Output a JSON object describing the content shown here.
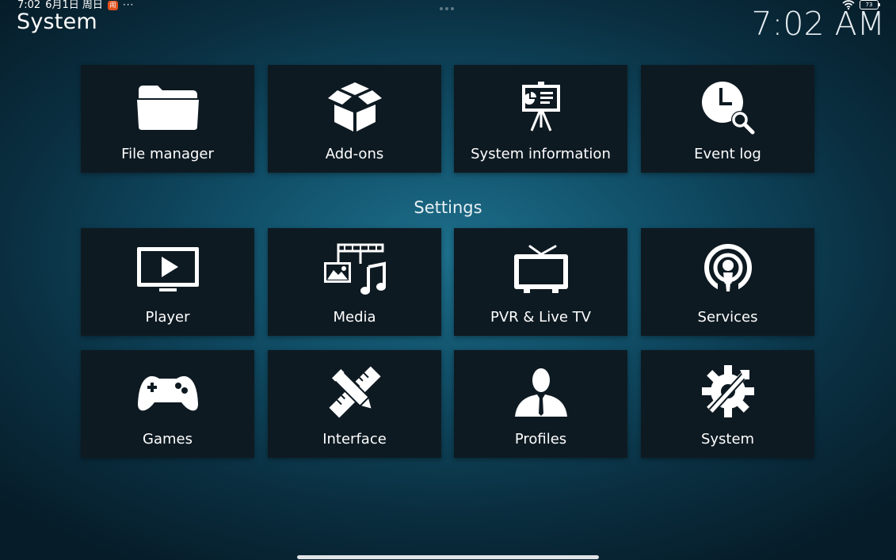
{
  "status_bar": {
    "time": "7:02",
    "date": "6月1日 周日",
    "app_badge": "闹",
    "more": "···",
    "battery": "73"
  },
  "header": {
    "title": "System",
    "clock": "7:02 AM"
  },
  "top_tiles": [
    {
      "label": "File manager",
      "icon": "folder-icon"
    },
    {
      "label": "Add-ons",
      "icon": "open-box-icon"
    },
    {
      "label": "System information",
      "icon": "presentation-easel-icon"
    },
    {
      "label": "Event log",
      "icon": "clock-search-icon"
    }
  ],
  "settings": {
    "title": "Settings",
    "tiles": [
      {
        "label": "Player",
        "icon": "monitor-play-icon"
      },
      {
        "label": "Media",
        "icon": "media-image-music-icon"
      },
      {
        "label": "PVR & Live TV",
        "icon": "tv-antenna-icon"
      },
      {
        "label": "Services",
        "icon": "podcast-broadcast-icon"
      },
      {
        "label": "Games",
        "icon": "gamepad-icon"
      },
      {
        "label": "Interface",
        "icon": "pencil-ruler-icon"
      },
      {
        "label": "Profiles",
        "icon": "user-silhouette-icon"
      },
      {
        "label": "System",
        "icon": "gear-wrench-icon"
      }
    ]
  }
}
